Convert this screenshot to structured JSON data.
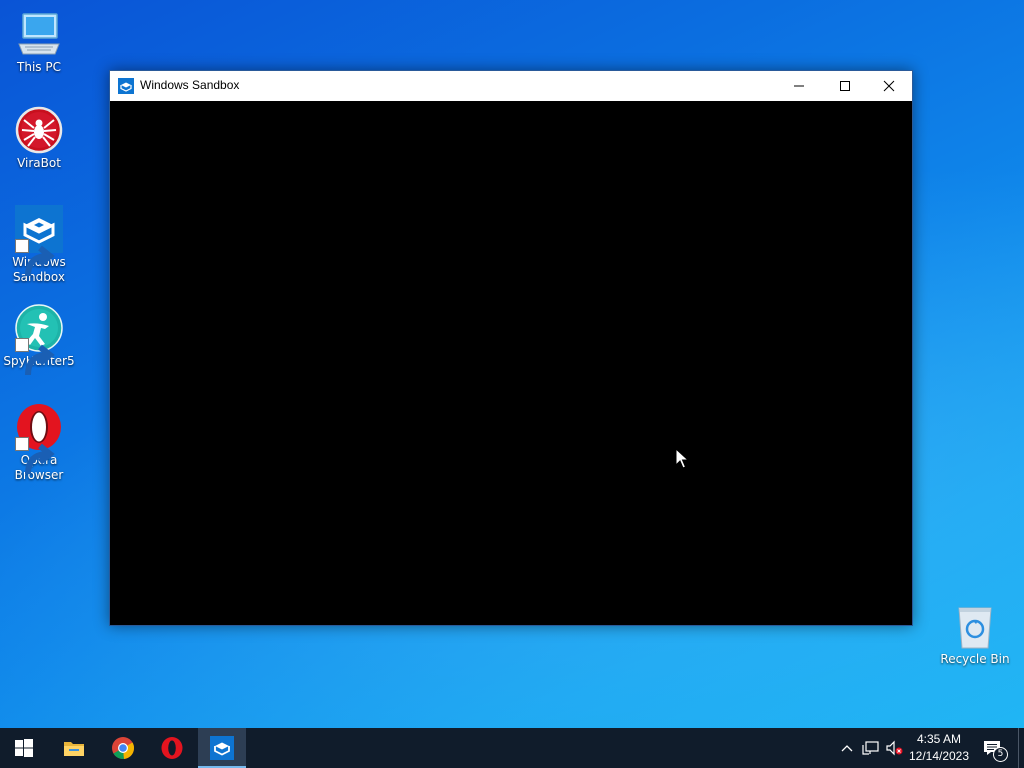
{
  "desktop": {
    "icons": [
      {
        "label": "This PC"
      },
      {
        "label": "ViraBot"
      },
      {
        "label": "Windows Sandbox"
      },
      {
        "label": "SpyHunter5"
      },
      {
        "label": "Opera Browser"
      },
      {
        "label": "Recycle Bin"
      }
    ]
  },
  "window": {
    "title": "Windows Sandbox",
    "controls": [
      "minimize",
      "maximize",
      "close"
    ]
  },
  "taskbar": {
    "pinned": [
      "start-icon",
      "file-explorer-icon",
      "chrome-icon",
      "opera-icon",
      "windows-sandbox-icon"
    ],
    "active": "windows-sandbox-icon",
    "clock": {
      "time": "4:35 AM",
      "date": "12/14/2023"
    },
    "notifications_count": "5"
  },
  "colors": {
    "taskbar": "#101c2b",
    "accent": "#0078d7",
    "window_content": "#000000"
  }
}
